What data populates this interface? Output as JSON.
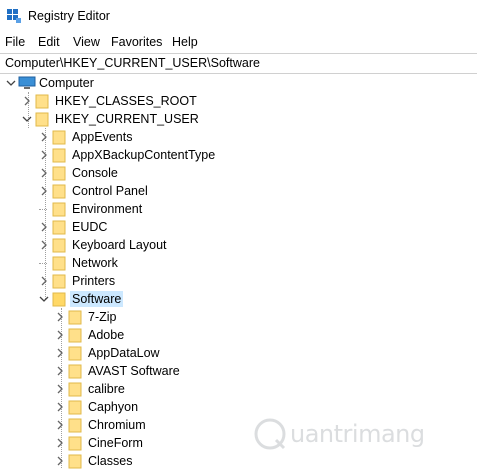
{
  "window": {
    "title": "Registry Editor"
  },
  "menu": [
    "File",
    "Edit",
    "View",
    "Favorites",
    "Help"
  ],
  "address": "Computer\\HKEY_CURRENT_USER\\Software",
  "tree": {
    "root": "Computer",
    "hkcr": "HKEY_CLASSES_ROOT",
    "hkcu": "HKEY_CURRENT_USER",
    "hkcu_children": [
      "AppEvents",
      "AppXBackupContentType",
      "Console",
      "Control Panel",
      "Environment",
      "EUDC",
      "Keyboard Layout",
      "Network",
      "Printers",
      "Software"
    ],
    "software_children": [
      "7-Zip",
      "Adobe",
      "AppDataLow",
      "AVAST Software",
      "calibre",
      "Caphyon",
      "Chromium",
      "CineForm",
      "Classes"
    ],
    "selected": "Software"
  },
  "watermark": {
    "text": "uantrimang"
  }
}
